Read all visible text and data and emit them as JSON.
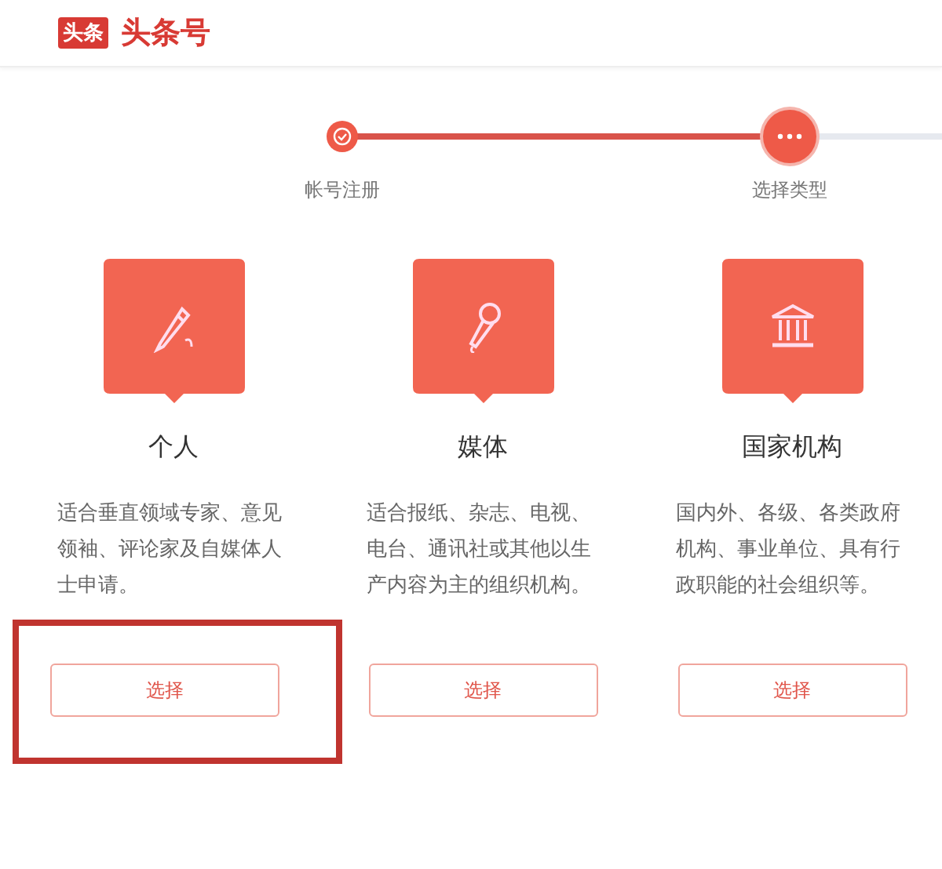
{
  "header": {
    "logo_badge": "头条",
    "logo_text": "头条号"
  },
  "steps": [
    {
      "label": "帐号注册",
      "kind": "done"
    },
    {
      "label": "选择类型",
      "kind": "current"
    }
  ],
  "cards": [
    {
      "title": "个人",
      "description": "适合垂直领域专家、意见领袖、评论家及自媒体人士申请。",
      "button": "选择",
      "highlighted": true
    },
    {
      "title": "媒体",
      "description": "适合报纸、杂志、电视、电台、通讯社或其他以生产内容为主的组织机构。",
      "button": "选择",
      "highlighted": false
    },
    {
      "title": "国家机构",
      "description": "国内外、各级、各类政府机构、事业单位、具有行政职能的社会组织等。",
      "button": "选择",
      "highlighted": false
    }
  ]
}
